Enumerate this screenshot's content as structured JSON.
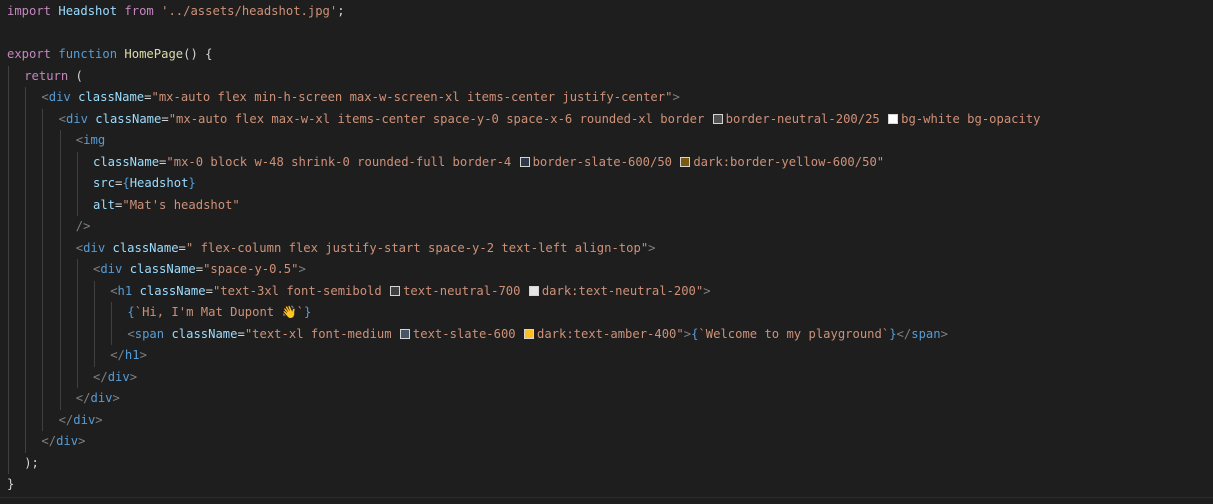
{
  "editor": {
    "lines": [
      {
        "indent": 0,
        "tokens": [
          [
            "kw",
            "import"
          ],
          [
            "plain",
            " "
          ],
          [
            "var",
            "Headshot"
          ],
          [
            "plain",
            " "
          ],
          [
            "kw",
            "from"
          ],
          [
            "plain",
            " "
          ],
          [
            "str",
            "'../assets/headshot.jpg'"
          ],
          [
            "plain",
            ";"
          ]
        ]
      },
      {
        "indent": 0,
        "tokens": []
      },
      {
        "indent": 0,
        "tokens": [
          [
            "kw",
            "export"
          ],
          [
            "plain",
            " "
          ],
          [
            "kwb",
            "function"
          ],
          [
            "plain",
            " "
          ],
          [
            "fn",
            "HomePage"
          ],
          [
            "plain",
            "() {"
          ]
        ]
      },
      {
        "indent": 1,
        "tokens": [
          [
            "kw",
            "return"
          ],
          [
            "plain",
            " ("
          ]
        ]
      },
      {
        "indent": 2,
        "tokens": [
          [
            "tagp",
            "<"
          ],
          [
            "tag",
            "div"
          ],
          [
            "plain",
            " "
          ],
          [
            "attr",
            "className"
          ],
          [
            "plain",
            "="
          ],
          [
            "str",
            "\"mx-auto flex min-h-screen max-w-screen-xl items-center justify-center\""
          ],
          [
            "tagp",
            ">"
          ]
        ]
      },
      {
        "indent": 3,
        "tokens": [
          [
            "tagp",
            "<"
          ],
          [
            "tag",
            "div"
          ],
          [
            "plain",
            " "
          ],
          [
            "attr",
            "className"
          ],
          [
            "plain",
            "="
          ],
          [
            "str",
            "\"mx-auto flex max-w-xl items-center space-y-0 space-x-6 rounded-xl border "
          ],
          [
            "sw",
            "#525252"
          ],
          [
            "str",
            "border-neutral-200/25 "
          ],
          [
            "sw",
            "#ffffff"
          ],
          [
            "str",
            "bg-white bg-opacity"
          ]
        ]
      },
      {
        "indent": 4,
        "tokens": [
          [
            "tagp",
            "<"
          ],
          [
            "tag",
            "img"
          ]
        ]
      },
      {
        "indent": 5,
        "tokens": [
          [
            "attr",
            "className"
          ],
          [
            "plain",
            "="
          ],
          [
            "str",
            "\"mx-0 block w-48 shrink-0 rounded-full border-4 "
          ],
          [
            "sw",
            "#2f3a48"
          ],
          [
            "str",
            "border-slate-600/50 "
          ],
          [
            "sw",
            "#7a5a10"
          ],
          [
            "str",
            "dark:border-yellow-600/50\""
          ]
        ]
      },
      {
        "indent": 5,
        "tokens": [
          [
            "attr",
            "src"
          ],
          [
            "plain",
            "="
          ],
          [
            "brace",
            "{"
          ],
          [
            "var",
            "Headshot"
          ],
          [
            "brace",
            "}"
          ]
        ]
      },
      {
        "indent": 5,
        "tokens": [
          [
            "attr",
            "alt"
          ],
          [
            "plain",
            "="
          ],
          [
            "str",
            "\"Mat's headshot\""
          ]
        ]
      },
      {
        "indent": 4,
        "tokens": [
          [
            "tagp",
            "/>"
          ]
        ]
      },
      {
        "indent": 4,
        "tokens": [
          [
            "tagp",
            "<"
          ],
          [
            "tag",
            "div"
          ],
          [
            "plain",
            " "
          ],
          [
            "attr",
            "className"
          ],
          [
            "plain",
            "="
          ],
          [
            "str",
            "\" flex-column flex justify-start space-y-2 text-left align-top\""
          ],
          [
            "tagp",
            ">"
          ]
        ]
      },
      {
        "indent": 5,
        "tokens": [
          [
            "tagp",
            "<"
          ],
          [
            "tag",
            "div"
          ],
          [
            "plain",
            " "
          ],
          [
            "attr",
            "className"
          ],
          [
            "plain",
            "="
          ],
          [
            "str",
            "\"space-y-0.5\""
          ],
          [
            "tagp",
            ">"
          ]
        ]
      },
      {
        "indent": 6,
        "tokens": [
          [
            "tagp",
            "<"
          ],
          [
            "tag",
            "h1"
          ],
          [
            "plain",
            " "
          ],
          [
            "attr",
            "className"
          ],
          [
            "plain",
            "="
          ],
          [
            "str",
            "\"text-3xl font-semibold "
          ],
          [
            "sw",
            "#404040"
          ],
          [
            "str",
            "text-neutral-700 "
          ],
          [
            "sw",
            "#e5e5e5"
          ],
          [
            "str",
            "dark:text-neutral-200\""
          ],
          [
            "tagp",
            ">"
          ]
        ]
      },
      {
        "indent": 7,
        "tokens": [
          [
            "brace",
            "{"
          ],
          [
            "str",
            "`Hi, I'm Mat Dupont 👋`"
          ],
          [
            "brace",
            "}"
          ]
        ]
      },
      {
        "indent": 7,
        "tokens": [
          [
            "tagp",
            "<"
          ],
          [
            "tag",
            "span"
          ],
          [
            "plain",
            " "
          ],
          [
            "attr",
            "className"
          ],
          [
            "plain",
            "="
          ],
          [
            "str",
            "\"text-xl font-medium "
          ],
          [
            "sw",
            "#475569"
          ],
          [
            "str",
            "text-slate-600 "
          ],
          [
            "sw",
            "#fbbf24"
          ],
          [
            "str",
            "dark:text-amber-400\""
          ],
          [
            "tagp",
            ">"
          ],
          [
            "brace",
            "{"
          ],
          [
            "str",
            "`Welcome to my playground`"
          ],
          [
            "brace",
            "}"
          ],
          [
            "tagp",
            "</"
          ],
          [
            "tag",
            "span"
          ],
          [
            "tagp",
            ">"
          ]
        ]
      },
      {
        "indent": 6,
        "tokens": [
          [
            "tagp",
            "</"
          ],
          [
            "tag",
            "h1"
          ],
          [
            "tagp",
            ">"
          ]
        ]
      },
      {
        "indent": 5,
        "tokens": [
          [
            "tagp",
            "</"
          ],
          [
            "tag",
            "div"
          ],
          [
            "tagp",
            ">"
          ]
        ]
      },
      {
        "indent": 4,
        "tokens": [
          [
            "tagp",
            "</"
          ],
          [
            "tag",
            "div"
          ],
          [
            "tagp",
            ">"
          ]
        ]
      },
      {
        "indent": 3,
        "tokens": [
          [
            "tagp",
            "</"
          ],
          [
            "tag",
            "div"
          ],
          [
            "tagp",
            ">"
          ]
        ]
      },
      {
        "indent": 2,
        "tokens": [
          [
            "tagp",
            "</"
          ],
          [
            "tag",
            "div"
          ],
          [
            "tagp",
            ">"
          ]
        ]
      },
      {
        "indent": 1,
        "tokens": [
          [
            "plain",
            ");"
          ]
        ]
      },
      {
        "indent": 0,
        "tokens": [
          [
            "plain",
            "}"
          ]
        ]
      }
    ]
  }
}
